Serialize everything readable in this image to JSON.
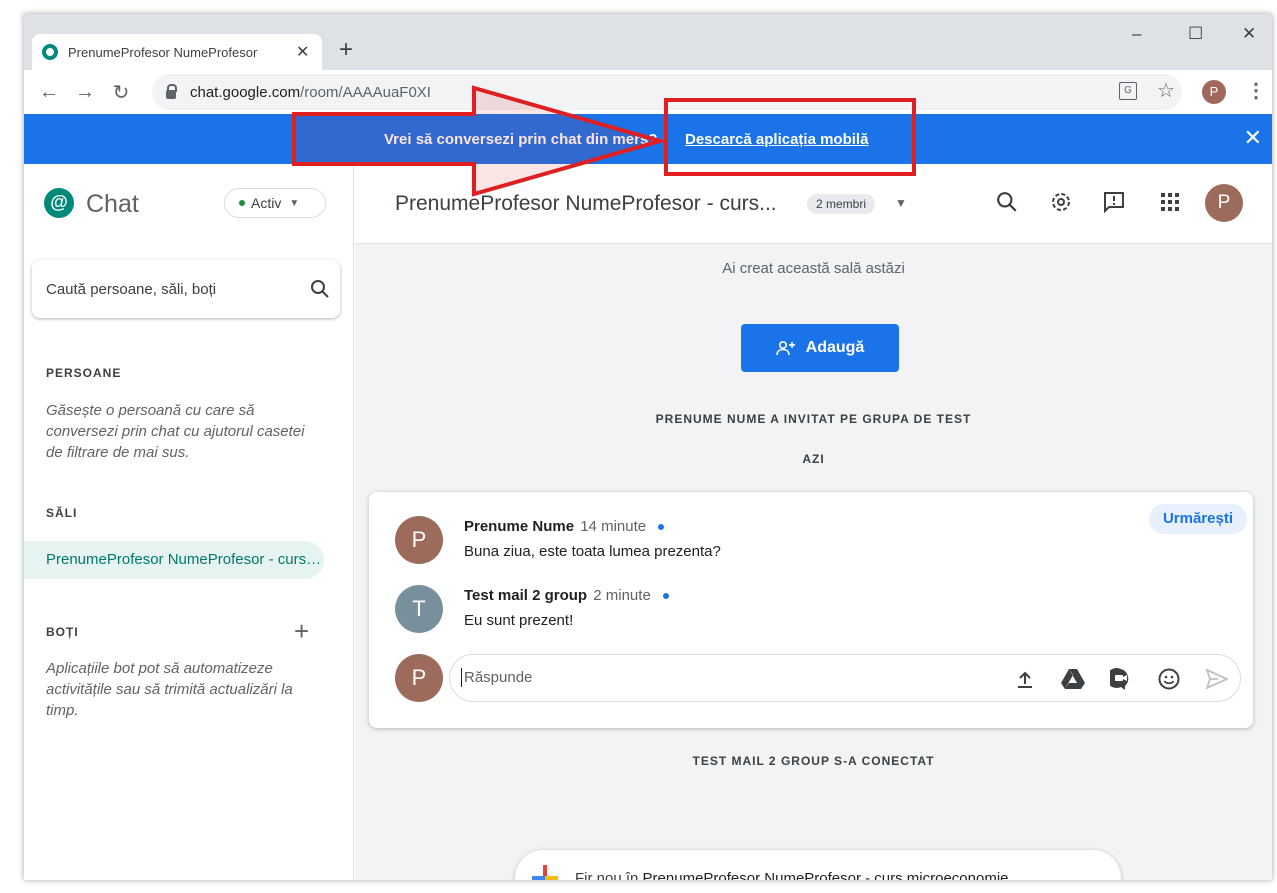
{
  "browser": {
    "tab_title": "PrenumeProfesor NumeProfesor",
    "tab_close": "✕",
    "new_tab": "+",
    "minimize": "–",
    "maximize": "☐",
    "close_window": "✕",
    "url_domain": "chat.google.com",
    "url_path": "/room/AAAAuaF0XI",
    "profile_initial": "P"
  },
  "banner": {
    "text": "Vrei să conversezi prin chat din mers?",
    "link": "Descarcă aplicația mobilă"
  },
  "sidebar": {
    "app_name": "Chat",
    "status": "Activ",
    "search_placeholder": "Caută persoane, săli, boți",
    "people_label": "PERSOANE",
    "people_hint": "Găsește o persoană cu care să conversezi prin chat cu ajutorul casetei de filtrare de mai sus.",
    "rooms_label": "SĂLI",
    "rooms": [
      "PrenumeProfesor NumeProfesor - curs microeconomie"
    ],
    "bots_label": "BOȚI",
    "bots_hint": "Aplicațiile bot pot să automatizeze activitățile sau să trimită actualizări la timp."
  },
  "header": {
    "room_title": "PrenumeProfesor NumeProfesor - curs...",
    "members": "2 membri",
    "avatar_initial": "P"
  },
  "main": {
    "created": "Ai creat această sală astăzi",
    "add_button": "Adaugă",
    "invite_notice": "PRENUME NUME A INVITAT PE GRUPA DE TEST",
    "today": "AZI",
    "follow": "Urmărești",
    "messages": [
      {
        "initial": "P",
        "name": "Prenume Nume",
        "time": "14 minute",
        "text": "Buna ziua, este toata lumea prezenta?",
        "color": "#9c6b5b"
      },
      {
        "initial": "T",
        "name": "Test mail 2 group",
        "time": "2 minute",
        "text": "Eu sunt prezent!",
        "color": "#78909c"
      }
    ],
    "reply_initial": "P",
    "reply_placeholder": "Răspunde",
    "joined_notice": "TEST MAIL 2 GROUP S-A CONECTAT",
    "new_thread_prefix": "Fir nou în",
    "new_thread_room": "PrenumeProfesor NumeProfesor - curs microeconomie"
  },
  "colors": {
    "accent": "#1a73e8",
    "chat_green": "#00897b",
    "annotation_red": "#e02020"
  }
}
